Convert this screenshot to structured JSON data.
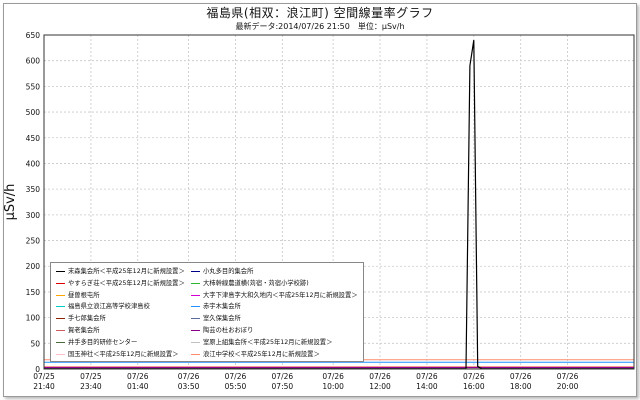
{
  "title": "福島県(相双：浪江町) 空間線量率グラフ",
  "subtitle": "最新データ:2014/07/26 21:50　単位：μSv/h",
  "chart_data": {
    "type": "line",
    "title": "福島県(相双：浪江町) 空間線量率グラフ",
    "subtitle": "最新データ:2014/07/26 21:50　単位：μSv/h",
    "xlabel": "",
    "ylabel": "μSv/h",
    "ylim": [
      0,
      650
    ],
    "yticks": [
      0,
      50,
      100,
      150,
      200,
      250,
      300,
      350,
      400,
      450,
      500,
      550,
      600,
      650
    ],
    "xlim": [
      "2014-07-25 21:40",
      "2014-07-26 22:50"
    ],
    "xticks": [
      {
        "date": "07/25",
        "time": "21:40"
      },
      {
        "date": "07/25",
        "time": "23:40"
      },
      {
        "date": "07/26",
        "time": "01:40"
      },
      {
        "date": "07/26",
        "time": "03:50"
      },
      {
        "date": "07/26",
        "time": "05:50"
      },
      {
        "date": "07/26",
        "time": "07:50"
      },
      {
        "date": "07/26",
        "time": "10:00"
      },
      {
        "date": "07/26",
        "time": "12:00"
      },
      {
        "date": "07/26",
        "time": "14:00"
      },
      {
        "date": "07/26",
        "time": "16:00"
      },
      {
        "date": "07/26",
        "time": "18:00"
      },
      {
        "date": "07/26",
        "time": "20:00"
      }
    ],
    "grid": true,
    "legend_position": "lower-left",
    "series": [
      {
        "name": "末森集会所＜平成25年12月に新規設置＞",
        "color": "#000000",
        "x": [
          "2014-07-25 21:40",
          "2014-07-26 15:30",
          "2014-07-26 15:40",
          "2014-07-26 15:50",
          "2014-07-26 16:00",
          "2014-07-26 16:10",
          "2014-07-26 16:20",
          "2014-07-26 16:30",
          "2014-07-26 22:50"
        ],
        "y": [
          0.5,
          0.5,
          0.5,
          590,
          640,
          5,
          0.5,
          0.5,
          0.5
        ]
      },
      {
        "name": "小丸多目的集会所",
        "color": "#00008b",
        "x": [
          "2014-07-25 21:40",
          "2014-07-26 22:50"
        ],
        "y": [
          2,
          2
        ]
      },
      {
        "name": "やすらぎ荘＜平成25年12月に新規設置＞",
        "color": "#dd0000",
        "x": [
          "2014-07-25 21:40",
          "2014-07-26 22:50"
        ],
        "y": [
          3,
          3
        ]
      },
      {
        "name": "大柿幹線農道横(苅宿・苅宿小学校跡)",
        "color": "#2eb82e",
        "x": [
          "2014-07-25 21:40",
          "2014-07-26 22:50"
        ],
        "y": [
          2.5,
          2.5
        ]
      },
      {
        "name": "昼曽根屯所",
        "color": "#ffa500",
        "x": [
          "2014-07-25 21:40",
          "2014-07-26 22:50"
        ],
        "y": [
          4,
          4
        ]
      },
      {
        "name": "大字下津島字大和久地内＜平成25年12月に新規設置＞",
        "color": "#d400d4",
        "x": [
          "2014-07-25 21:40",
          "2014-07-26 22:50"
        ],
        "y": [
          3.5,
          3.5
        ]
      },
      {
        "name": "福島県立浪江高等学校津島校",
        "color": "#00cccc",
        "x": [
          "2014-07-25 21:40",
          "2014-07-26 22:50"
        ],
        "y": [
          1.5,
          1.5
        ]
      },
      {
        "name": "赤宇木集会所",
        "color": "#1e90ff",
        "x": [
          "2014-07-25 21:40",
          "2014-07-26 22:50"
        ],
        "y": [
          13,
          13
        ]
      },
      {
        "name": "手七郎集会所",
        "color": "#8b2500",
        "x": [
          "2014-07-25 21:40",
          "2014-07-26 22:50"
        ],
        "y": [
          1.2,
          1.2
        ]
      },
      {
        "name": "室久保集会所",
        "color": "#5a6a9c",
        "x": [
          "2014-07-25 21:40",
          "2014-07-26 22:50"
        ],
        "y": [
          1.8,
          1.8
        ]
      },
      {
        "name": "賀老集会所",
        "color": "#cd5c5c",
        "x": [
          "2014-07-25 21:40",
          "2014-07-26 22:50"
        ],
        "y": [
          2.2,
          2.2
        ]
      },
      {
        "name": "陶芸の杜おおぼり",
        "color": "#8b008b",
        "x": [
          "2014-07-25 21:40",
          "2014-07-26 22:50"
        ],
        "y": [
          2.8,
          2.8
        ]
      },
      {
        "name": "井手多目的研修センター",
        "color": "#4a6a3a",
        "x": [
          "2014-07-25 21:40",
          "2014-07-26 22:50"
        ],
        "y": [
          1.0,
          1.0
        ]
      },
      {
        "name": "室原上組集会所＜平成25年12月に新規設置＞",
        "color": "#c0c0c0",
        "x": [
          "2014-07-25 21:40",
          "2014-07-26 22:50"
        ],
        "y": [
          0.8,
          0.8
        ]
      },
      {
        "name": "国玉神社＜平成25年12月に新規設置＞",
        "color": "#ffc0cb",
        "x": [
          "2014-07-25 21:40",
          "2014-07-26 22:50"
        ],
        "y": [
          0.6,
          0.6
        ]
      },
      {
        "name": "浪江中学校＜平成25年12月に新規設置＞",
        "color": "#ff8c69",
        "x": [
          "2014-07-25 21:40",
          "2014-07-26 22:50"
        ],
        "y": [
          18,
          18
        ]
      }
    ]
  }
}
